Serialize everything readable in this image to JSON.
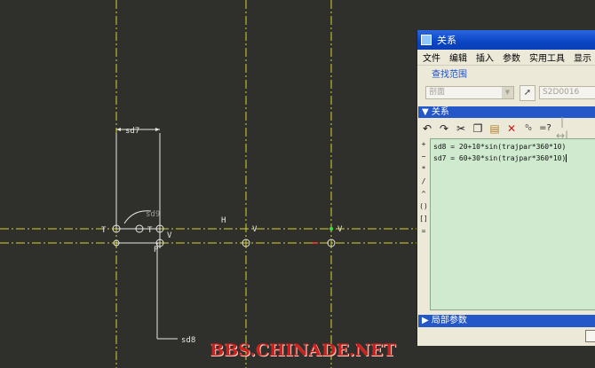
{
  "cad": {
    "dimensions": {
      "sd7": "sd7",
      "sd8": "sd8",
      "sd9": "sd9"
    },
    "constraints": {
      "h": "H",
      "t1": "T",
      "t2": "T",
      "v1": "V",
      "v2": "V",
      "v3": "V",
      "p": "P"
    }
  },
  "dialog": {
    "title": "关系",
    "menu": [
      "文件",
      "编辑",
      "插入",
      "参数",
      "实用工具",
      "显示"
    ],
    "search_scope_label": "查找范围",
    "scope_select_value": "剖面",
    "entity_value": "S2D0016",
    "relations_header": "关系",
    "toolbar_icons": [
      "undo-icon",
      "redo-icon",
      "cut-icon",
      "copy-icon",
      "paste-icon",
      "delete-icon",
      "evaluate-icon",
      "verify-icon",
      "sort-icon"
    ],
    "operators": [
      "+",
      "−",
      "*",
      "/",
      "^",
      "()",
      "[]",
      "="
    ],
    "relations": [
      "sd8 = 20+10*sin(trajpar*360*10)",
      "sd7 = 60+30*sin(trajpar*360*10)"
    ],
    "local_params_label": "局部参数"
  },
  "watermark": "BBS.CHINADE.NET",
  "colors": {
    "background": "#2f2f2b",
    "centerline": "#d8d030",
    "sketch": "#e8e8e0",
    "editor_bg": "#cfeacf",
    "titlebar": "#0a45c4",
    "watermark": "#cf2020"
  }
}
